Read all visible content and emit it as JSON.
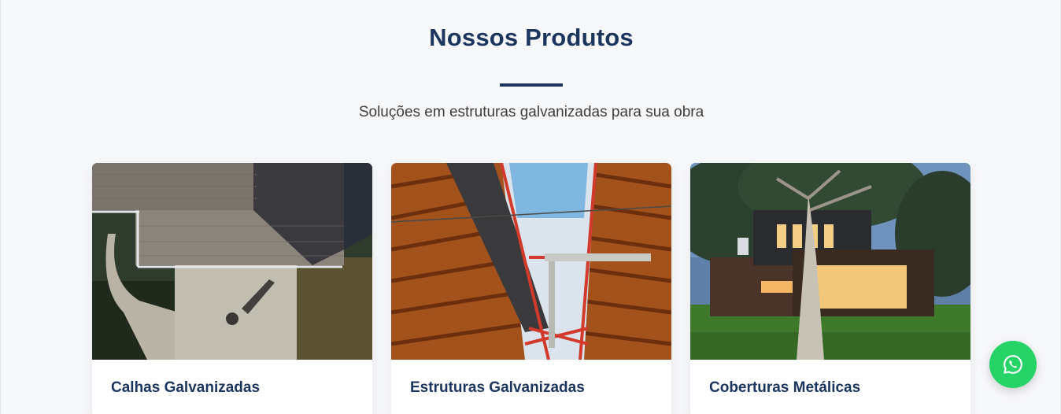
{
  "section": {
    "title": "Nossos Produtos",
    "subtitle": "Soluções em estruturas galvanizadas para sua obra"
  },
  "products": [
    {
      "title": "Calhas Galvanizadas",
      "image_icon": "aerial-roof-photo"
    },
    {
      "title": "Estruturas Galvanizadas",
      "image_icon": "roof-structure-photo"
    },
    {
      "title": "Coberturas Metálicas",
      "image_icon": "modern-house-photo"
    }
  ],
  "whatsapp": {
    "icon": "whatsapp-icon",
    "color": "#25d366"
  },
  "colors": {
    "heading": "#1b355e",
    "background": "#f7f8fa"
  }
}
